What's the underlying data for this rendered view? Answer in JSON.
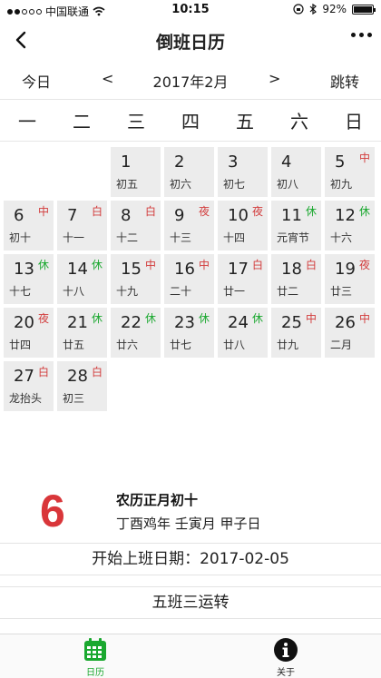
{
  "status_bar": {
    "carrier": "中国联通",
    "time": "10:15",
    "battery": "92%"
  },
  "navbar": {
    "title": "倒班日历"
  },
  "toolbar": {
    "today_label": "今日",
    "prev_label": "<",
    "month_label": "2017年2月",
    "next_label": ">",
    "jump_label": "跳转"
  },
  "weekdays": [
    "一",
    "二",
    "三",
    "四",
    "五",
    "六",
    "日"
  ],
  "calendar": {
    "leading_blanks": 2,
    "days": [
      {
        "day": "1",
        "lunar": "初五",
        "shift": "",
        "kind": ""
      },
      {
        "day": "2",
        "lunar": "初六",
        "shift": "",
        "kind": ""
      },
      {
        "day": "3",
        "lunar": "初七",
        "shift": "",
        "kind": ""
      },
      {
        "day": "4",
        "lunar": "初八",
        "shift": "",
        "kind": ""
      },
      {
        "day": "5",
        "lunar": "初九",
        "shift": "中",
        "kind": "zhong"
      },
      {
        "day": "6",
        "lunar": "初十",
        "shift": "中",
        "kind": "zhong"
      },
      {
        "day": "7",
        "lunar": "十一",
        "shift": "白",
        "kind": "bai"
      },
      {
        "day": "8",
        "lunar": "十二",
        "shift": "白",
        "kind": "bai"
      },
      {
        "day": "9",
        "lunar": "十三",
        "shift": "夜",
        "kind": "ye"
      },
      {
        "day": "10",
        "lunar": "十四",
        "shift": "夜",
        "kind": "ye"
      },
      {
        "day": "11",
        "lunar": "元宵节",
        "shift": "休",
        "kind": "xiu"
      },
      {
        "day": "12",
        "lunar": "十六",
        "shift": "休",
        "kind": "xiu"
      },
      {
        "day": "13",
        "lunar": "十七",
        "shift": "休",
        "kind": "xiu"
      },
      {
        "day": "14",
        "lunar": "十八",
        "shift": "休",
        "kind": "xiu"
      },
      {
        "day": "15",
        "lunar": "十九",
        "shift": "中",
        "kind": "zhong"
      },
      {
        "day": "16",
        "lunar": "二十",
        "shift": "中",
        "kind": "zhong"
      },
      {
        "day": "17",
        "lunar": "廿一",
        "shift": "白",
        "kind": "bai"
      },
      {
        "day": "18",
        "lunar": "廿二",
        "shift": "白",
        "kind": "bai"
      },
      {
        "day": "19",
        "lunar": "廿三",
        "shift": "夜",
        "kind": "ye"
      },
      {
        "day": "20",
        "lunar": "廿四",
        "shift": "夜",
        "kind": "ye"
      },
      {
        "day": "21",
        "lunar": "廿五",
        "shift": "休",
        "kind": "xiu"
      },
      {
        "day": "22",
        "lunar": "廿六",
        "shift": "休",
        "kind": "xiu"
      },
      {
        "day": "23",
        "lunar": "廿七",
        "shift": "休",
        "kind": "xiu"
      },
      {
        "day": "24",
        "lunar": "廿八",
        "shift": "休",
        "kind": "xiu"
      },
      {
        "day": "25",
        "lunar": "廿九",
        "shift": "中",
        "kind": "zhong"
      },
      {
        "day": "26",
        "lunar": "二月",
        "shift": "中",
        "kind": "zhong"
      },
      {
        "day": "27",
        "lunar": "龙抬头",
        "shift": "白",
        "kind": "bai"
      },
      {
        "day": "28",
        "lunar": "初三",
        "shift": "白",
        "kind": "bai"
      }
    ]
  },
  "selected": {
    "big_day": "6",
    "lunar_line": "农历正月初十",
    "ganzhi_line": "丁酉鸡年 壬寅月 甲子日"
  },
  "start_date_label": "开始上班日期：2017-02-05",
  "shift_mode_label": "五班三运转",
  "tabbar": {
    "calendar_label": "日历",
    "about_label": "关于"
  },
  "colors": {
    "accent_green": "#1aa82f",
    "shift_red": "#d23b3b",
    "big_day_red": "#d9363a",
    "cell_bg": "#ececec"
  }
}
